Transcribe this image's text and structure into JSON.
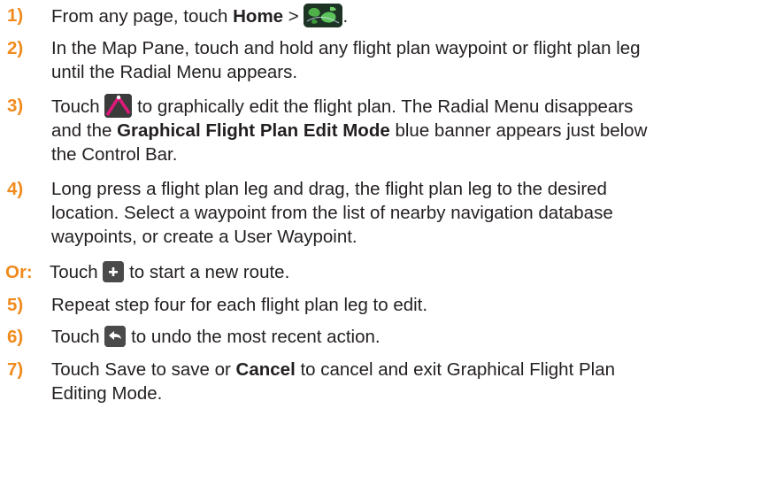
{
  "steps": [
    {
      "num": "1)",
      "pre": "From any page, touch ",
      "bold1": "Home",
      "mid": " > ",
      "post": ".",
      "icon": "map-app-icon"
    },
    {
      "num": "2)",
      "line1": "In the Map Pane, touch and hold any flight plan waypoint or flight plan leg",
      "line2": "until the Radial Menu appears."
    },
    {
      "num": "3)",
      "pre": "Touch ",
      "post": " to graphically edit the flight plan.  The Radial Menu disappears",
      "line2_pre": "and the ",
      "line2_bold": "Graphical Flight Plan Edit Mode",
      "line2_post": " blue banner appears just below",
      "line3": "the Control Bar.",
      "icon": "graphical-edit-icon"
    },
    {
      "num": "4)",
      "line1": "Long press a flight plan leg and drag, the flight plan leg to the desired",
      "line2": "location.  Select a waypoint from the list of nearby navigation database",
      "line3": "waypoints, or create a User Waypoint."
    },
    {
      "num": "Or:",
      "pre": "Touch ",
      "post": " to start a new route.",
      "icon": "add-icon"
    },
    {
      "num": "5)",
      "line1": "Repeat step four for each flight plan leg to edit."
    },
    {
      "num": "6)",
      "pre": "Touch ",
      "post": " to undo the most recent action.",
      "icon": "undo-icon"
    },
    {
      "num": "7)",
      "pre": "Touch Save to save or ",
      "bold1": "Cancel",
      "post": " to cancel and exit Graphical Flight Plan",
      "line2": "Editing Mode."
    }
  ],
  "colors": {
    "step_number": "#f08a1c",
    "body_text": "#231f20",
    "icon_bg": "#4a4a4a"
  }
}
